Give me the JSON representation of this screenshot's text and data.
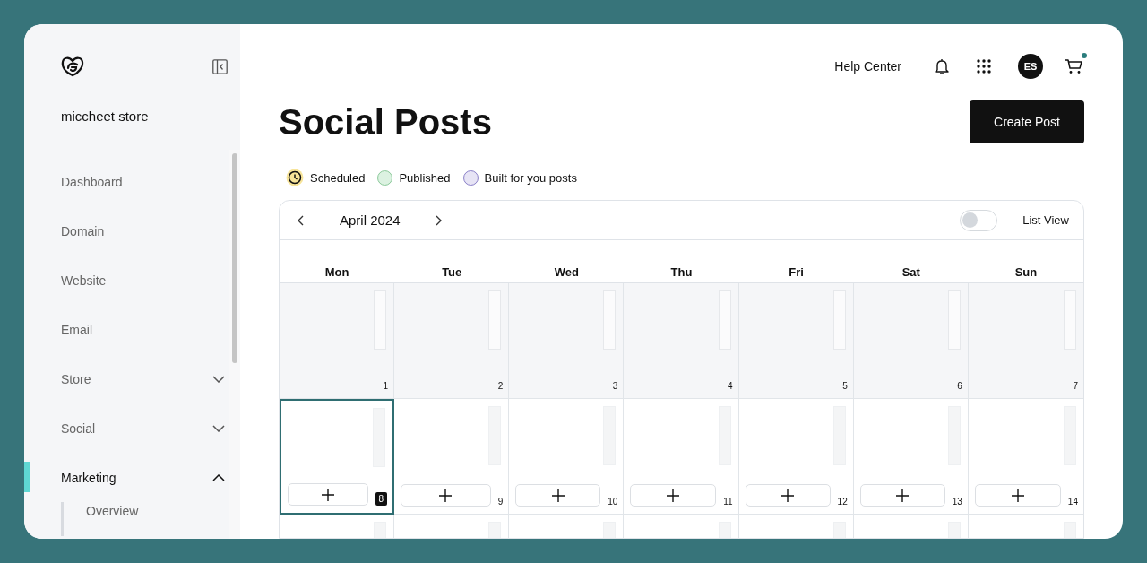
{
  "sidebar": {
    "store_name": "miccheet store",
    "items": [
      {
        "label": "Dashboard",
        "kind": "plain",
        "selected": false
      },
      {
        "label": "Domain",
        "kind": "plain",
        "selected": false
      },
      {
        "label": "Website",
        "kind": "plain",
        "selected": false
      },
      {
        "label": "Email",
        "kind": "plain",
        "selected": false
      },
      {
        "label": "Store",
        "kind": "expandable",
        "selected": false,
        "expanded": false
      },
      {
        "label": "Social",
        "kind": "expandable",
        "selected": false,
        "expanded": false
      },
      {
        "label": "Marketing",
        "kind": "expandable",
        "selected": true,
        "expanded": true,
        "children": [
          {
            "label": "Overview"
          }
        ]
      }
    ]
  },
  "topbar": {
    "help": "Help Center",
    "avatar": "ES",
    "cart_badge": true
  },
  "page": {
    "title": "Social Posts",
    "create_button": "Create Post"
  },
  "legend": [
    {
      "label": "Scheduled",
      "kind": "clock",
      "color": "#f7e49a"
    },
    {
      "label": "Published",
      "kind": "dot",
      "color": "#dcf2e1"
    },
    {
      "label": "Built for you posts",
      "kind": "dot",
      "color": "#e7e4f5"
    }
  ],
  "calendar": {
    "month": "April 2024",
    "list_view": {
      "label": "List View",
      "on": false
    },
    "weekdays": [
      "Mon",
      "Tue",
      "Wed",
      "Thu",
      "Fri",
      "Sat",
      "Sun"
    ],
    "weeks": [
      [
        {
          "day": "1",
          "past": true,
          "selected": false
        },
        {
          "day": "2",
          "past": true,
          "selected": false
        },
        {
          "day": "3",
          "past": true,
          "selected": false
        },
        {
          "day": "4",
          "past": true,
          "selected": false
        },
        {
          "day": "5",
          "past": true,
          "selected": false
        },
        {
          "day": "6",
          "past": true,
          "selected": false
        },
        {
          "day": "7",
          "past": true,
          "selected": false
        }
      ],
      [
        {
          "day": "8",
          "past": false,
          "selected": true
        },
        {
          "day": "9",
          "past": false,
          "selected": false
        },
        {
          "day": "10",
          "past": false,
          "selected": false
        },
        {
          "day": "11",
          "past": false,
          "selected": false
        },
        {
          "day": "12",
          "past": false,
          "selected": false
        },
        {
          "day": "13",
          "past": false,
          "selected": false
        },
        {
          "day": "14",
          "past": false,
          "selected": false
        }
      ]
    ]
  }
}
